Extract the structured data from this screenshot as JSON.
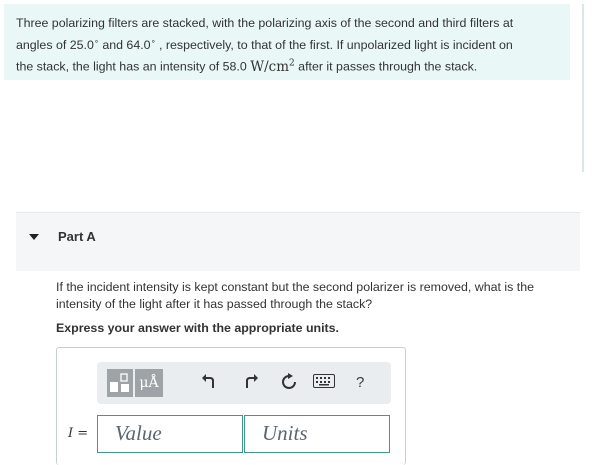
{
  "problem": {
    "line1": "Three polarizing filters are stacked, with the polarizing axis of the second and third filters at",
    "line2_a": "angles of 25.0",
    "line2_b": " and 64.0",
    "line2_c": " , respectively, to that of the first. If unpolarized light is incident on",
    "line3_a": "the stack, the light has an intensity of 58.0 ",
    "unit_main": "W/cm",
    "unit_exp": "2",
    "line3_b": " after it passes through the stack."
  },
  "part": {
    "title": "Part A",
    "expanded": true
  },
  "question": "If the incident intensity is kept constant but the second polarizer is removed, what is the intensity of the light after it has passed through the stack?",
  "instruction": "Express your answer with the appropriate units.",
  "toolbar": {
    "templates_icon": "templates-icon",
    "units_label": "μÅ",
    "undo_icon": "undo-icon",
    "redo_icon": "redo-icon",
    "reset_icon": "reset-icon",
    "keyboard_icon": "keyboard-icon",
    "help_label": "?"
  },
  "answer": {
    "variable": "I",
    "equals": "=",
    "value_placeholder": "Value",
    "units_placeholder": "Units"
  },
  "colors": {
    "problem_bg": "#e9f7f7",
    "field_border": "#3f9a8c",
    "toolbar_button": "#9ea3a7"
  }
}
